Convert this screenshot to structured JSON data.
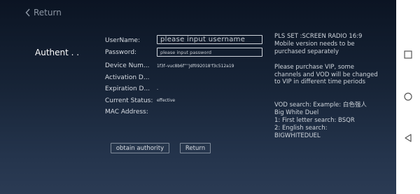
{
  "header": {
    "return_label": "Return"
  },
  "auth": {
    "title": "Authent . .",
    "username_label": "UserName:",
    "username_placeholder": "please input username",
    "password_label": "Password:",
    "password_placeholder": "please input password",
    "device_label": "Device Num...",
    "device_value": "1f3f–vuc8b6f”’’Jdf092018’f3c512a19",
    "activation_label": "Activation D...",
    "activation_value": "",
    "expiration_label": "Expiration D...",
    "expiration_value": "-",
    "status_label": "Current Status:",
    "status_value": "effective",
    "mac_label": "MAC Address:",
    "mac_value": ""
  },
  "buttons": {
    "obtain_label": "obtain authority",
    "return_label": "Return"
  },
  "info": {
    "line1": "PLS SET :SCREEN RADIO 16:9",
    "line2": "Mobile version needs to be purchased separately",
    "para2": "Please purchase VIP, some channels and VOD will be changed to VIP in different time periods",
    "vod_title": "VOD search: Example: 白色强人 Big White Duel",
    "vod_line1": "1: First letter search: BSQR",
    "vod_line2": "2: English search: BIGWHITEDUEL"
  },
  "colors": {
    "bg_top": "#0b1423",
    "bg_bottom": "#2b3b54",
    "text": "#d8dde4",
    "navbar": "#ffffff"
  }
}
